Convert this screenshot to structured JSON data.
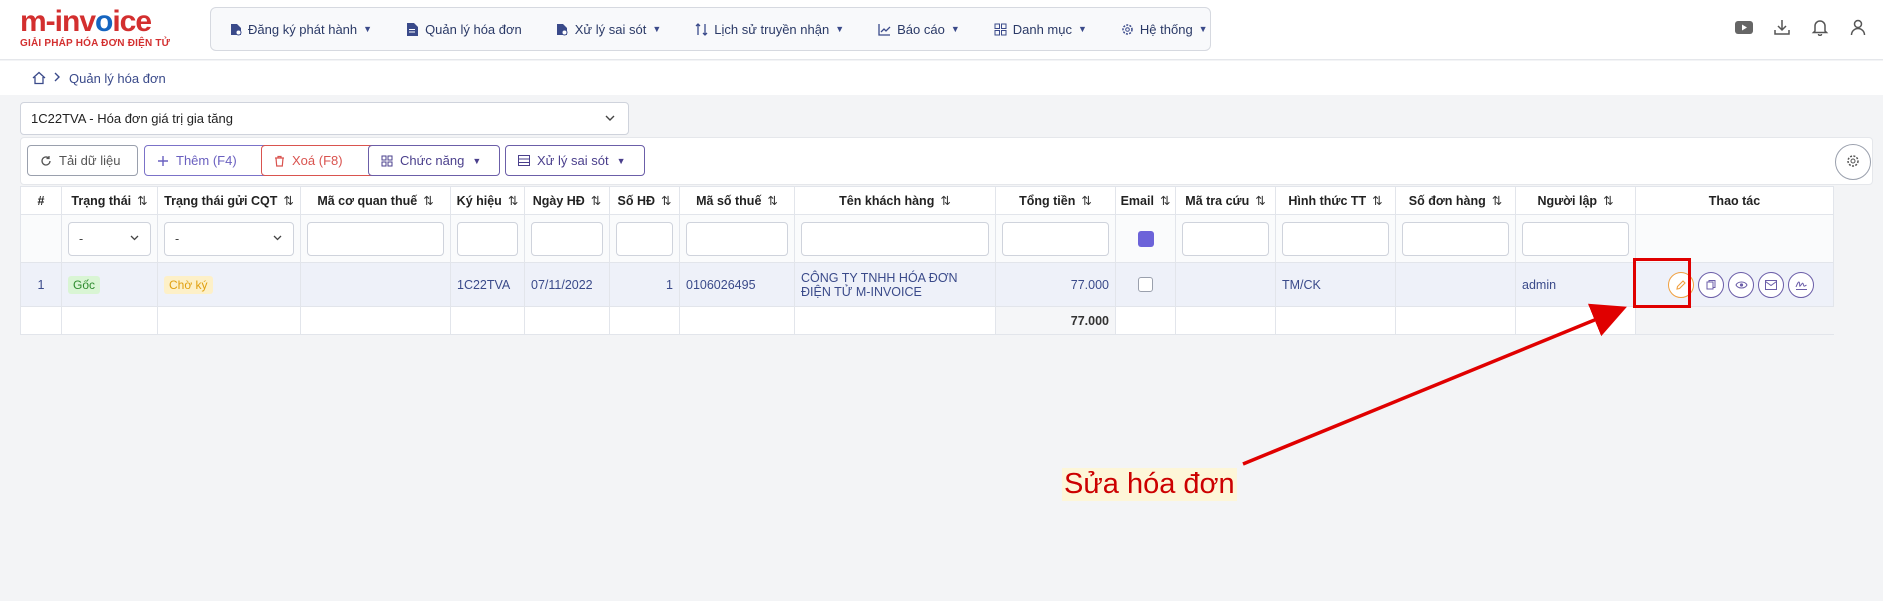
{
  "logo": {
    "main_red": "m-inv",
    "main_blue": "o",
    "main_rest": "ice",
    "sub": "GIẢI PHÁP HÓA ĐƠN ĐIỆN TỬ"
  },
  "nav": [
    {
      "label": "Đăng ký phát hành",
      "icon": "file-register-icon",
      "dropdown": true
    },
    {
      "label": "Quản lý hóa đơn",
      "icon": "invoice-icon",
      "dropdown": false
    },
    {
      "label": "Xử lý sai sót",
      "icon": "file-error-icon",
      "dropdown": true
    },
    {
      "label": "Lịch sử truyền nhận",
      "icon": "transfer-icon",
      "dropdown": true
    },
    {
      "label": "Báo cáo",
      "icon": "chart-icon",
      "dropdown": true
    },
    {
      "label": "Danh mục",
      "icon": "grid-icon",
      "dropdown": true
    },
    {
      "label": "Hệ thống",
      "icon": "gear-icon",
      "dropdown": true
    }
  ],
  "breadcrumb": {
    "current": "Quản lý hóa đơn"
  },
  "template_select": {
    "value": "1C22TVA - Hóa đơn giá trị gia tăng"
  },
  "toolbar": {
    "reload": "Tải dữ liệu",
    "add": "Thêm (F4)",
    "delete": "Xoá (F8)",
    "functions": "Chức năng",
    "errors": "Xử lý sai sót"
  },
  "table": {
    "columns": [
      "#",
      "Trạng thái",
      "Trạng thái gửi CQT",
      "Mã cơ quan thuế",
      "Ký hiệu",
      "Ngày HĐ",
      "Số HĐ",
      "Mã số thuế",
      "Tên khách hàng",
      "Tổng tiền",
      "Email",
      "Mã tra cứu",
      "Hình thức TT",
      "Số đơn hàng",
      "Người lập",
      "Thao tác"
    ],
    "filter_select_placeholder": "-",
    "row": {
      "index": "1",
      "status": "Gốc",
      "cqt_status": "Chờ ký",
      "tax_office_code": "",
      "symbol": "1C22TVA",
      "date": "07/11/2022",
      "number": "1",
      "tax_code": "0106026495",
      "customer": "CÔNG TY TNHH HÓA ĐƠN ĐIỆN TỬ M-INVOICE",
      "total": "77.000",
      "payment": "TM/CK",
      "creator": "admin"
    },
    "sum_total": "77.000"
  },
  "annotation": "Sửa hóa đơn",
  "colors": {
    "accent": "#6c63d9",
    "danger": "#d9534f",
    "highlight": "#e00000",
    "nav_text": "#2b3a67"
  }
}
